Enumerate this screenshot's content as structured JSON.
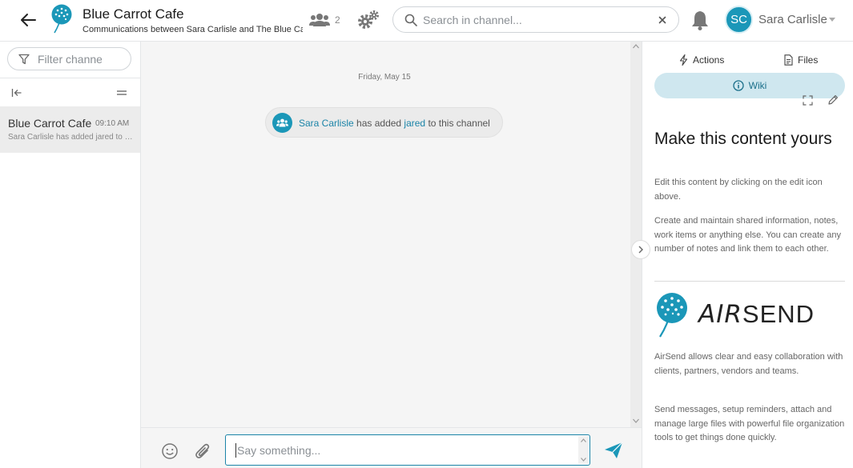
{
  "header": {
    "title": "Blue Carrot Cafe",
    "subtitle": "Communications between Sara Carlisle and The Blue Carrot Cafe",
    "members_count": "2",
    "search_placeholder": "Search in channel...",
    "user_initials": "SC",
    "user_name": "Sara Carlisle"
  },
  "sidebar": {
    "filter_placeholder": "Filter channels",
    "channels": [
      {
        "name": "Blue Carrot Cafe",
        "time": "09:10 AM",
        "preview": "Sara Carlisle has added jared to this channel"
      }
    ]
  },
  "chat": {
    "date_label": "Friday, May 15",
    "event": {
      "actor": "Sara Carlisle",
      "verb": " has added ",
      "target": "jared",
      "suffix": " to this channel"
    }
  },
  "composer": {
    "placeholder": "Say something..."
  },
  "right_panel": {
    "tabs": {
      "actions": "Actions",
      "files": "Files",
      "wiki": "Wiki"
    },
    "wiki": {
      "title": "Make this content yours",
      "p1": "Edit this content by clicking on the edit icon above.",
      "p2": "Create and maintain shared information, notes, work items or anything else. You can create any number of notes and link them to each other.",
      "brand_air": "AIR",
      "brand_send": "SEND",
      "p3": "AirSend allows clear and easy collaboration with clients, partners, vendors and teams.",
      "p4": "Send messages, setup reminders, attach and manage large files with powerful file organization tools to get things done quickly."
    }
  },
  "colors": {
    "accent": "#1b97b8",
    "link": "#1b84a8",
    "wiki_tab_bg": "#cfe7ef",
    "chat_bg": "#f5f5f5",
    "selected_item_bg": "#ececec"
  },
  "icons": {
    "back": "arrow-left-icon",
    "members": "users-icon",
    "settings": "gears-icon",
    "search": "search-icon",
    "clear": "close-icon",
    "notifications": "bell-icon",
    "filter": "funnel-icon",
    "collapse": "collapse-left-icon",
    "menu": "menu-icon",
    "emoji": "smiley-icon",
    "attach": "paperclip-icon",
    "send": "send-icon",
    "actions": "bolt-icon",
    "files": "document-icon",
    "wiki": "info-icon",
    "fullscreen": "fullscreen-icon",
    "edit": "pencil-icon"
  }
}
